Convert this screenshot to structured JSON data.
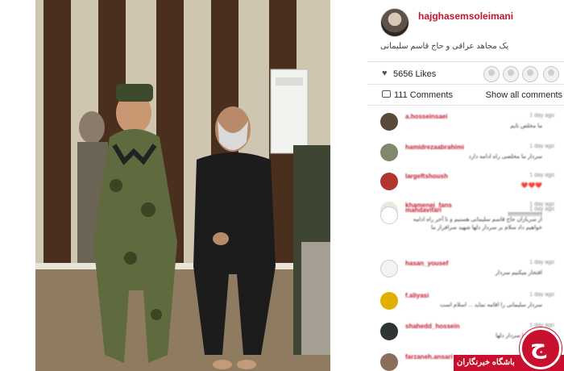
{
  "post": {
    "owner_username": "hajghasemsoleimani",
    "caption": "یک مجاهد عراقی و حاج قاسم سلیمانی"
  },
  "engagement": {
    "likes_text": "5656 Likes",
    "comments_text": "111 Comments",
    "show_all_label": "Show all comments",
    "like_icon": "heart-icon",
    "comment_icon": "comment-icon"
  },
  "comments": [
    {
      "user": "a.hosseinsaei",
      "time": "1 day ago",
      "text": "ما مخلص تایم"
    },
    {
      "user": "hamidrezaabrahimi",
      "time": "1 day ago",
      "text": "سردار ما مخلصی راه ادامه دارد"
    },
    {
      "user": "largeftshoush",
      "time": "1 day ago",
      "text": "❤️❤️❤️"
    },
    {
      "user": "khamenei_fans",
      "time": "1 day ago",
      "text": "!!!!!!!!!!!!!!!!!!!!!!"
    },
    {
      "user": "mahdavifari",
      "time": "1 day ago",
      "text": "از سربازان حاج قاسم سلیمانی هستیم و تا آخر راه ادامه خواهیم داد سلام بر سردار دلها شهید سرافراز ما"
    },
    {
      "user": "hasan_yousef",
      "time": "1 day ago",
      "text": "افتخار میکنیم سردار"
    },
    {
      "user": "f.aliyasi",
      "time": "1 day ago",
      "text": "سردار سلیمانی را اقامه نماید ... اسلام است"
    },
    {
      "user": "shahedd_hossein",
      "time": "1 day ago",
      "text": "افتخار ما سردار دلها"
    },
    {
      "user": "farzaneh.ansari",
      "time": "1 day ago",
      "text": ""
    }
  ],
  "watermark": {
    "text": "باشگاه خبرنگاران",
    "glyph": "ج"
  }
}
